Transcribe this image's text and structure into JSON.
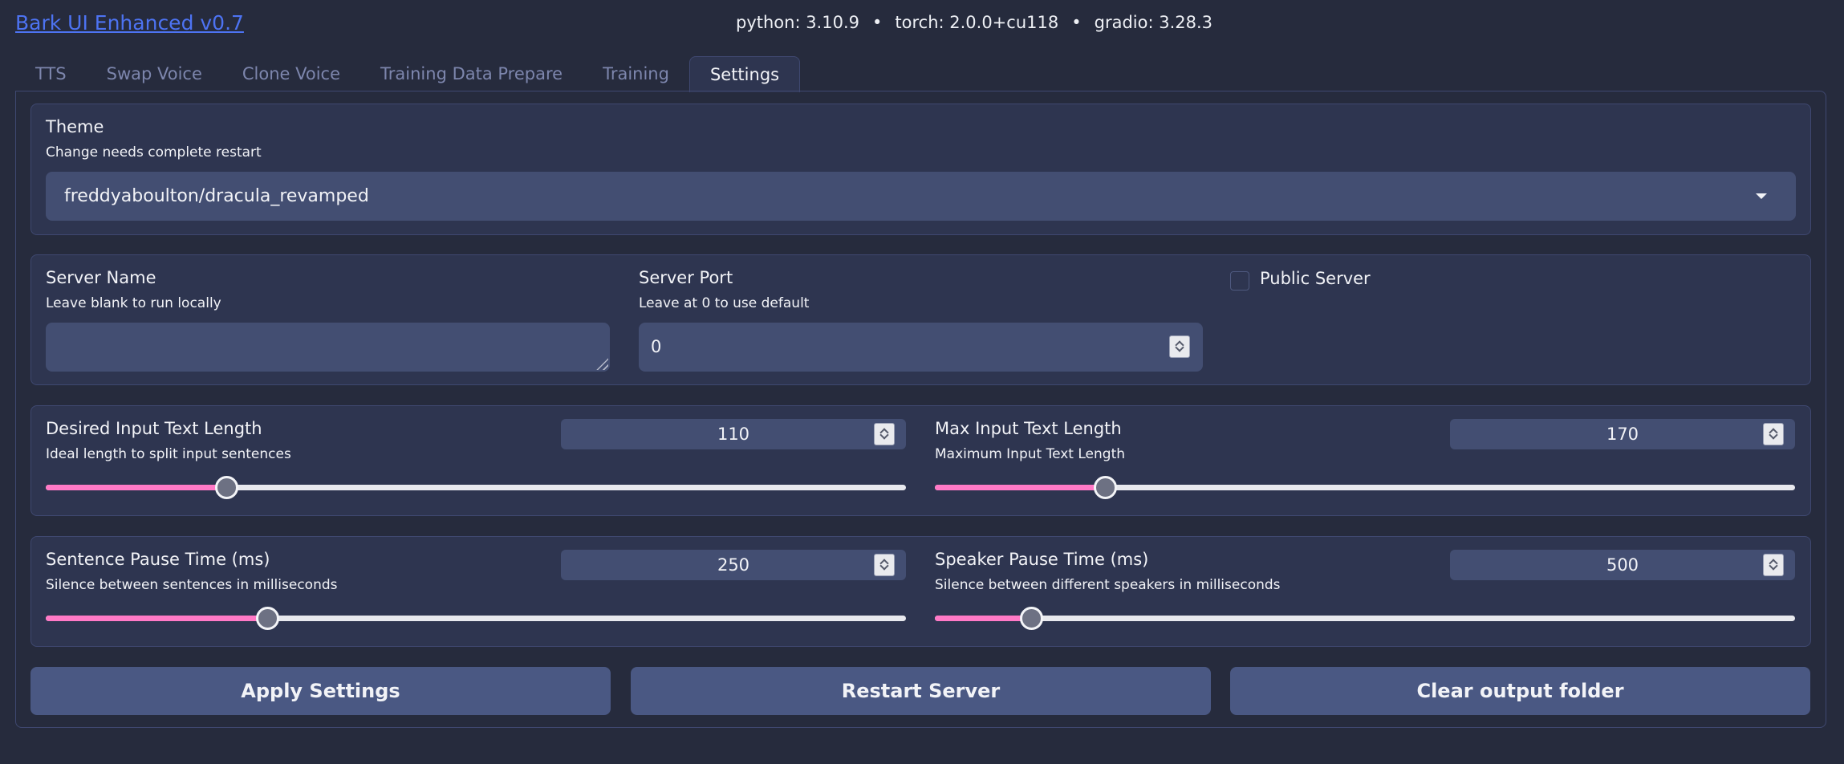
{
  "app": {
    "title": "Bark UI Enhanced v0.7",
    "python_version": "python: 3.10.9",
    "torch_version": "torch: 2.0.0+cu118",
    "gradio_version": "gradio: 3.28.3",
    "separator": "•"
  },
  "tabs": [
    {
      "label": "TTS",
      "active": false
    },
    {
      "label": "Swap Voice",
      "active": false
    },
    {
      "label": "Clone Voice",
      "active": false
    },
    {
      "label": "Training Data Prepare",
      "active": false
    },
    {
      "label": "Training",
      "active": false
    },
    {
      "label": "Settings",
      "active": true
    }
  ],
  "theme": {
    "label": "Theme",
    "info": "Change needs complete restart",
    "selected": "freddyaboulton/dracula_revamped"
  },
  "server": {
    "name_label": "Server Name",
    "name_info": "Leave blank to run locally",
    "name_value": "",
    "port_label": "Server Port",
    "port_info": "Leave at 0 to use default",
    "port_value": "0",
    "public_label": "Public Server",
    "public_checked": false
  },
  "sliders": {
    "desired_input": {
      "label": "Desired Input Text Length",
      "info": "Ideal length to split input sentences",
      "value": "110",
      "fraction": 0.21
    },
    "max_input": {
      "label": "Max Input Text Length",
      "info": "Maximum Input Text Length",
      "value": "170",
      "fraction": 0.198
    },
    "sentence_pause": {
      "label": "Sentence Pause Time (ms)",
      "info": "Silence between sentences in milliseconds",
      "value": "250",
      "fraction": 0.257
    },
    "speaker_pause": {
      "label": "Speaker Pause Time (ms)",
      "info": "Silence between different speakers in milliseconds",
      "value": "500",
      "fraction": 0.112
    }
  },
  "buttons": {
    "apply": "Apply Settings",
    "restart": "Restart Server",
    "clear": "Clear output folder"
  },
  "colors": {
    "background": "#262b3d",
    "panel": "#2e3550",
    "input": "#434e72",
    "accent": "#ff79c6",
    "link": "#4d73f2",
    "button": "#4a5883"
  }
}
